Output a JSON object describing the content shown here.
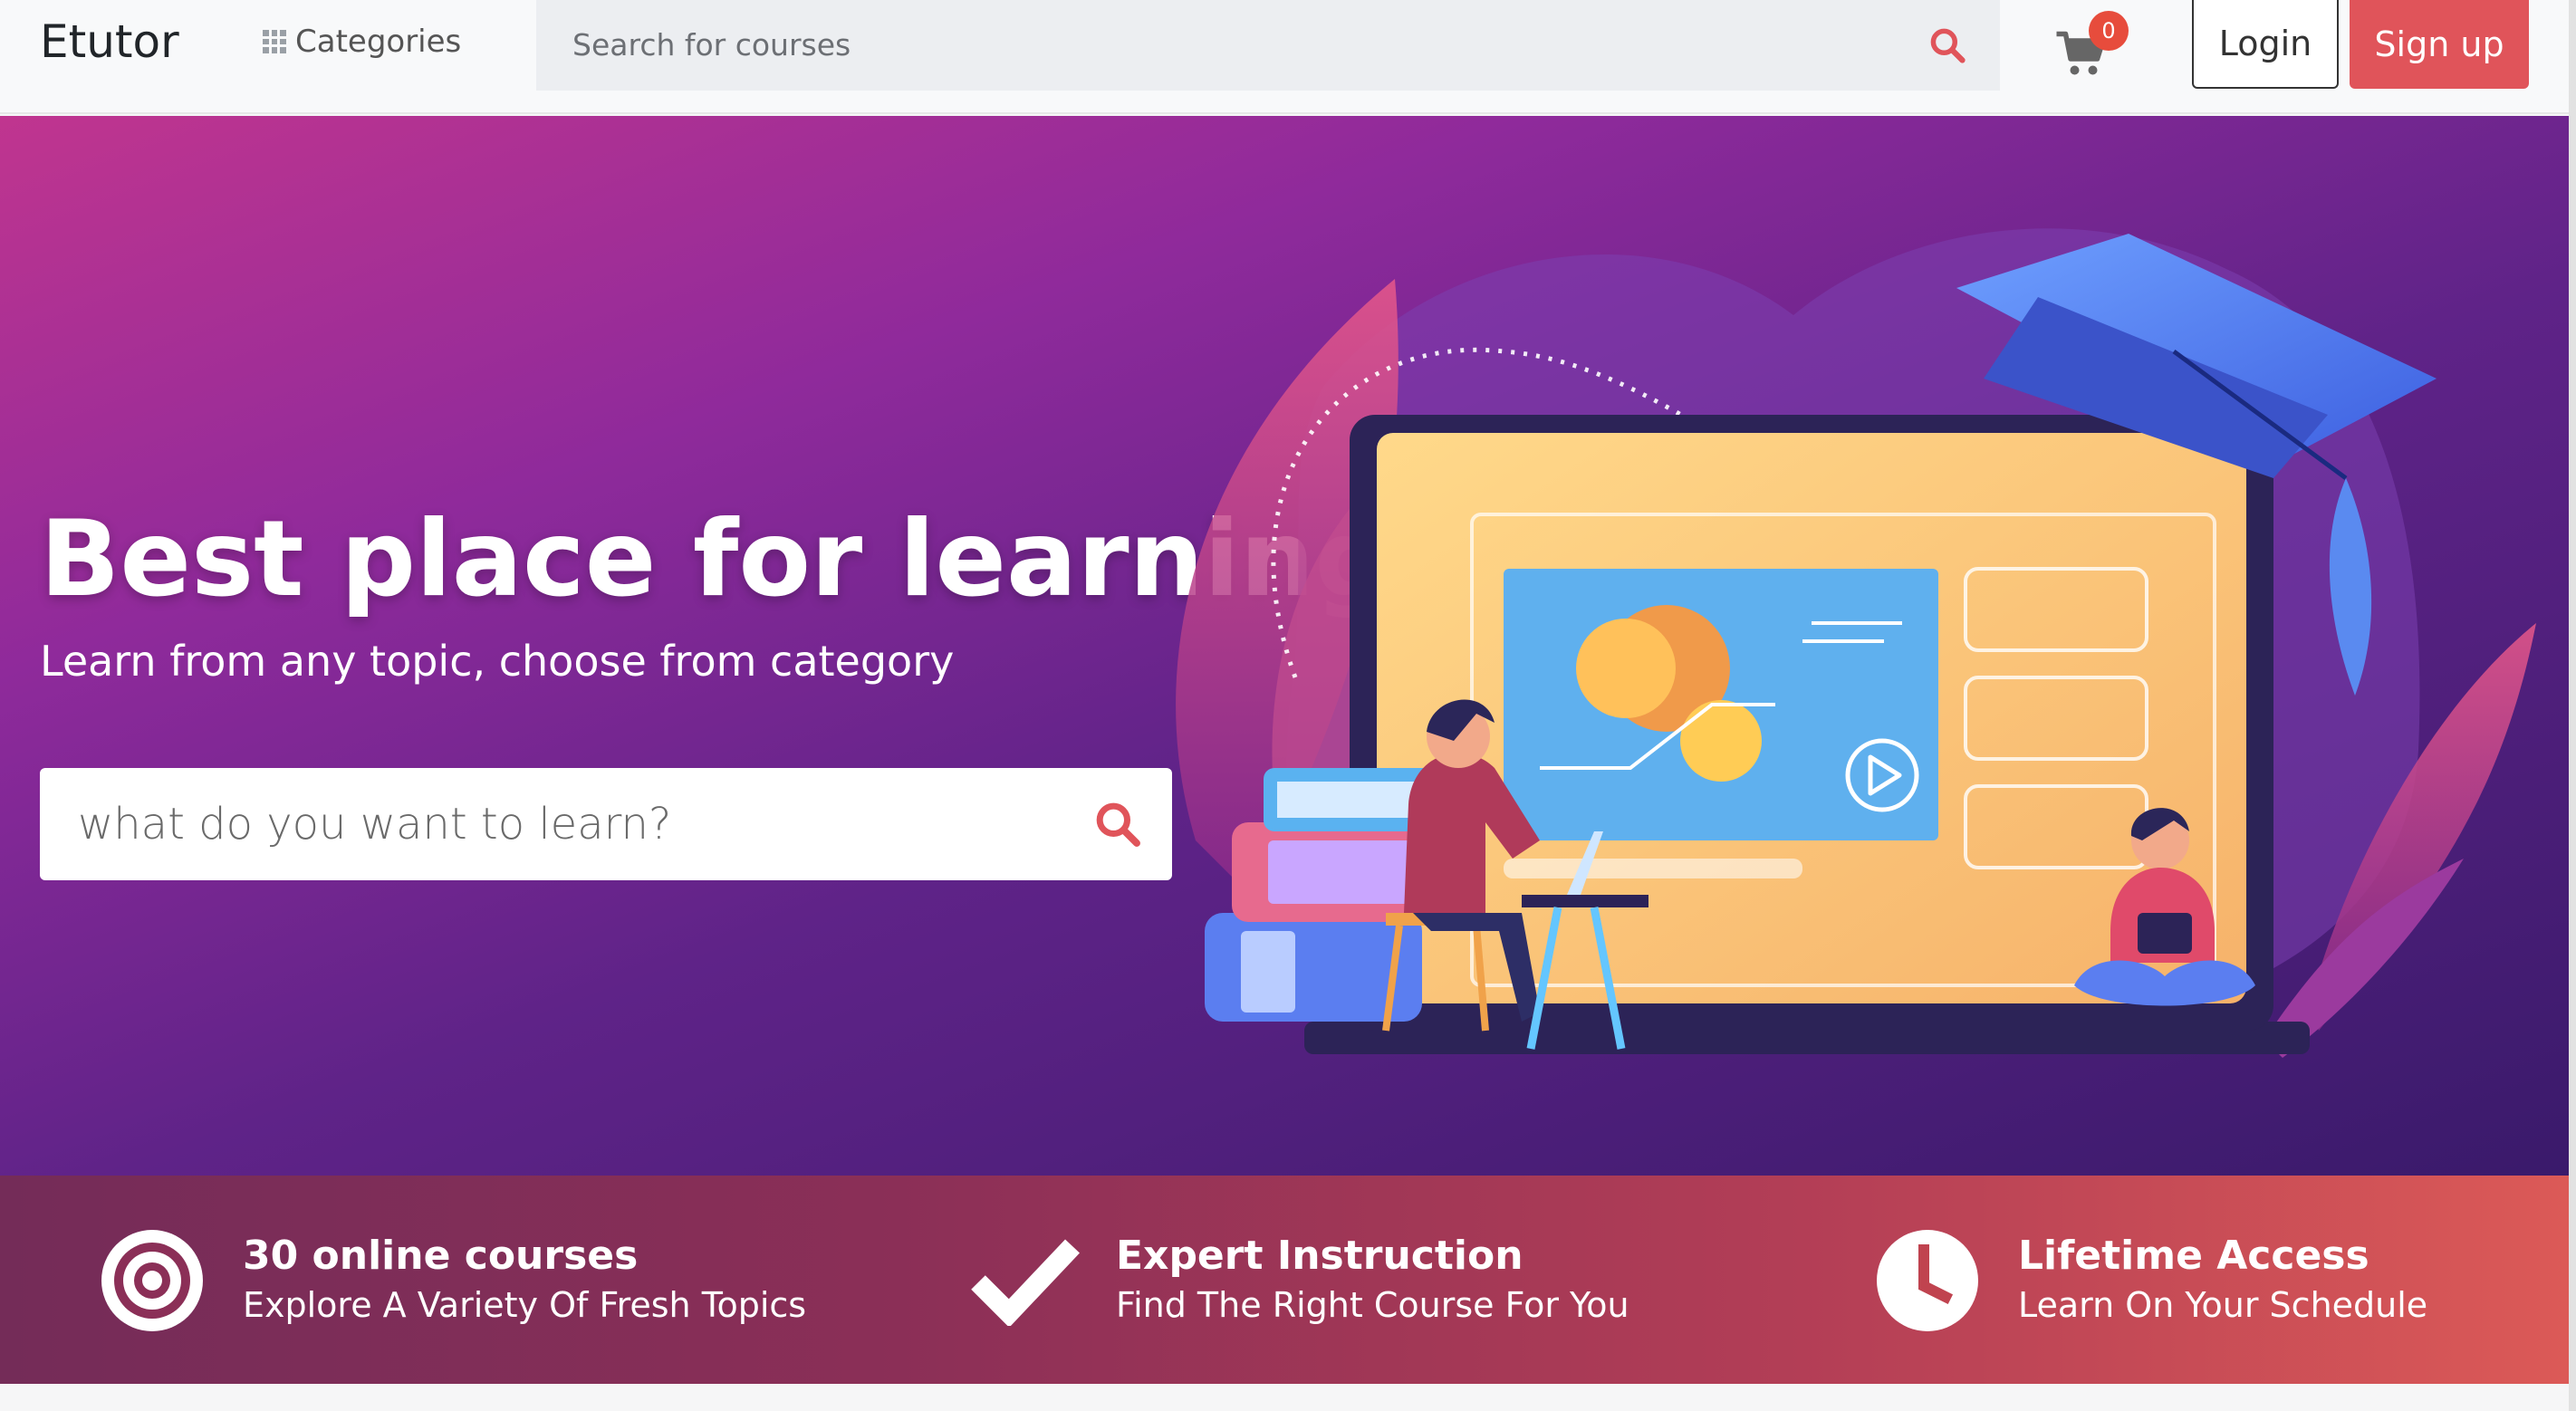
{
  "navbar": {
    "brand": "Etutor",
    "categories_label": "Categories",
    "search_placeholder": "Search for courses",
    "cart_count": "0",
    "login_label": "Login",
    "signup_label": "Sign up"
  },
  "hero": {
    "title": "Best place for learning",
    "subtitle": "Learn from any topic, choose from category",
    "search_placeholder": "what do you want to learn?"
  },
  "features": [
    {
      "icon": "target-icon",
      "title": "30 online courses",
      "description": "Explore A Variety Of Fresh Topics"
    },
    {
      "icon": "checkmark-icon",
      "title": "Expert Instruction",
      "description": "Find The Right Course For You"
    },
    {
      "icon": "clock-icon",
      "title": "Lifetime Access",
      "description": "Learn On Your Schedule"
    }
  ],
  "colors": {
    "accent": "#e0545a",
    "hero_gradient_start": "#c0358f",
    "hero_gradient_end": "#3a1a6b",
    "features_gradient_start": "#742c58",
    "features_gradient_end": "#dc5a57"
  }
}
